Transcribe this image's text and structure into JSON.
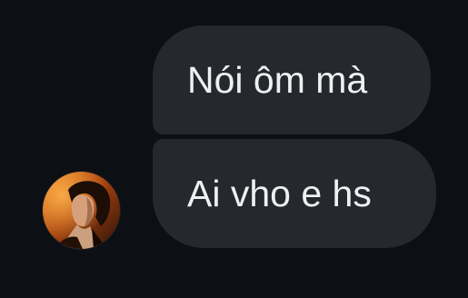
{
  "conversation": {
    "messages": [
      {
        "text": "Nói ôm mà"
      },
      {
        "text": "Ai vho e hs"
      }
    ],
    "sender": {
      "avatar_icon": "profile-photo",
      "avatar_colors": [
        "#f08a2a",
        "#2a1508",
        "#d4a07a"
      ]
    }
  },
  "theme": {
    "background": "#0c0f14",
    "bubble_color": "#25282d",
    "text_color": "#eef0f2"
  }
}
